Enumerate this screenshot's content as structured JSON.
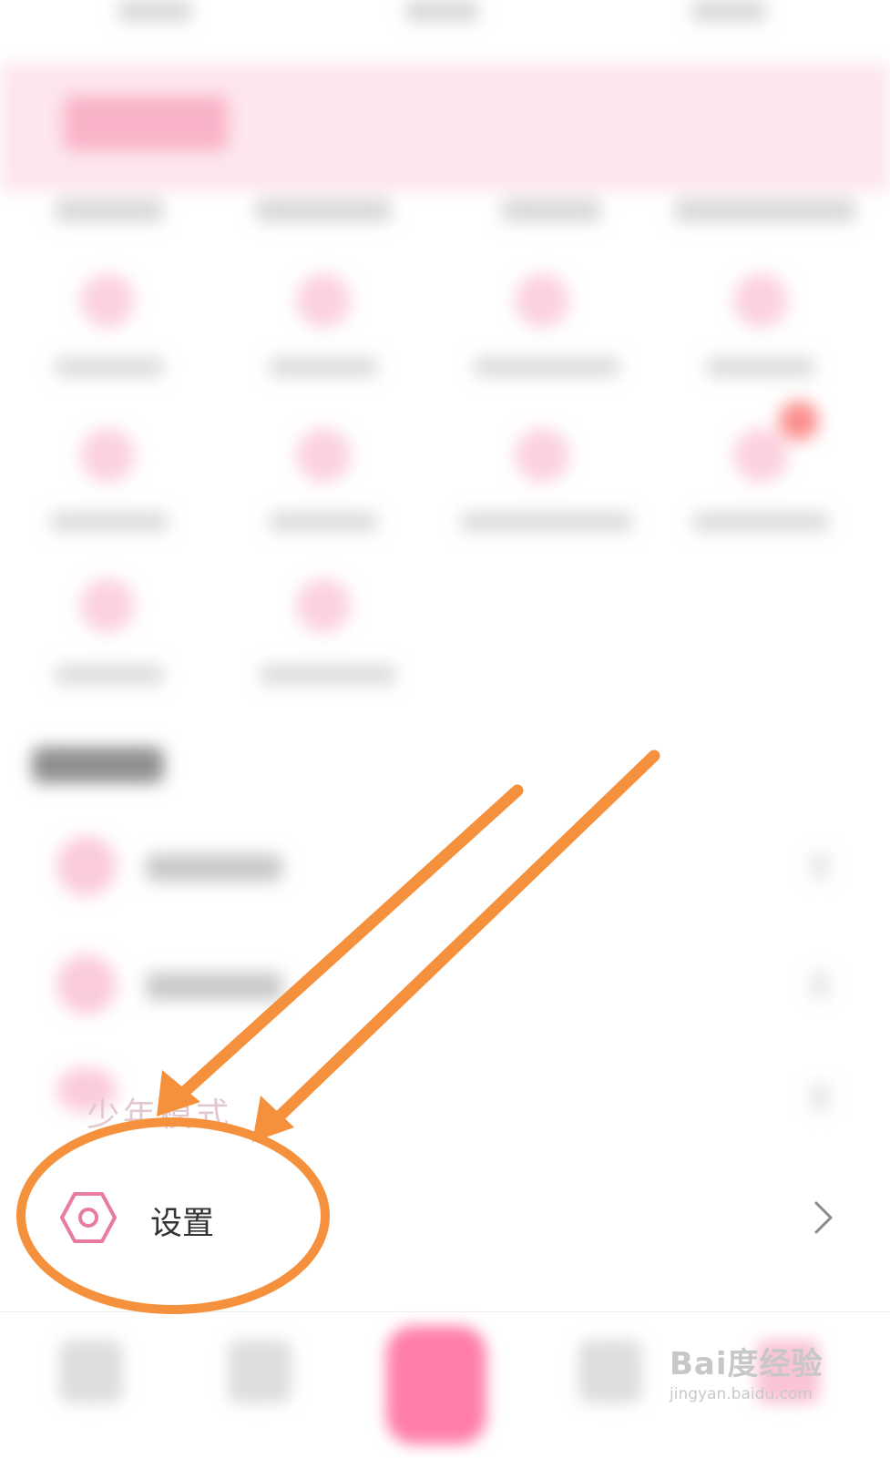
{
  "settings": {
    "label": "设置",
    "icon": "settings-hex-icon",
    "chevron": "chevron-right-icon"
  },
  "partially_visible_text": "少年模式",
  "colors": {
    "accent_pink": "#e87ba0",
    "annotation_orange": "#f5913c"
  },
  "annotations": [
    "orange-arrow",
    "orange-arrow",
    "orange-circle"
  ],
  "watermark": {
    "main": "Bai度经验",
    "sub": "jingyan.baidu.com"
  }
}
